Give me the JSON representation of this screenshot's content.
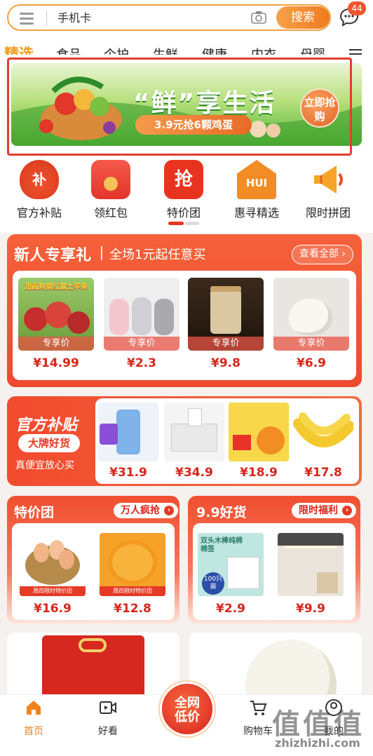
{
  "search": {
    "placeholder_value": "手机卡",
    "button_label": "搜索"
  },
  "header": {
    "message_badge": "44"
  },
  "categories": [
    "精选",
    "食品",
    "个护",
    "生鲜",
    "健康",
    "内衣",
    "母婴"
  ],
  "banner": {
    "title": "“鲜”享生活",
    "promo": "3.9元抢6颗鸡蛋",
    "buy_label": "立即抢购"
  },
  "quick_nav": [
    {
      "label": "官方补贴",
      "icon_text": "补"
    },
    {
      "label": "领红包",
      "icon_text": ""
    },
    {
      "label": "特价团",
      "icon_text": "抢"
    },
    {
      "label": "惠寻精选",
      "icon_text": "HUI"
    },
    {
      "label": "限时拼团",
      "icon_text": ""
    }
  ],
  "new_user": {
    "title": "新人专享礼",
    "subtitle": "全场1元起任意买",
    "view_all": "查看全部",
    "tag": "专享价",
    "products": [
      {
        "price": "¥14.99",
        "overlay": "甜面刺猬红富士苹果"
      },
      {
        "price": "¥2.3"
      },
      {
        "price": "¥9.8"
      },
      {
        "price": "¥6.9"
      }
    ]
  },
  "official_subsidy": {
    "title": "官方补贴",
    "pill": "大牌好货",
    "subtitle": "真便宜放心买",
    "products": [
      {
        "price": "¥31.9"
      },
      {
        "price": "¥34.9"
      },
      {
        "price": "¥18.9"
      },
      {
        "price": "¥17.8"
      }
    ]
  },
  "special_group": {
    "title": "特价团",
    "pill": "万人疯抢",
    "tag": "周四限时特价团",
    "products": [
      {
        "price": "¥16.9"
      },
      {
        "price": "¥12.8"
      }
    ]
  },
  "good_deals": {
    "title": "9.9好货",
    "pill": "限时福利",
    "products": [
      {
        "price": "¥2.9",
        "overlay": "双头木棒纯棉棉签",
        "badge": "100只装"
      },
      {
        "price": "¥9.9"
      }
    ]
  },
  "tabbar": {
    "home": "首页",
    "watch": "好看",
    "center": "全网低价",
    "cart": "购物车",
    "mine": "我的"
  },
  "watermark": {
    "big": "值值值",
    "small": "zhizhizhi.com"
  },
  "colors": {
    "accent": "#f0821f",
    "price": "#d6261b",
    "highlight_box": "#e53c2d"
  }
}
